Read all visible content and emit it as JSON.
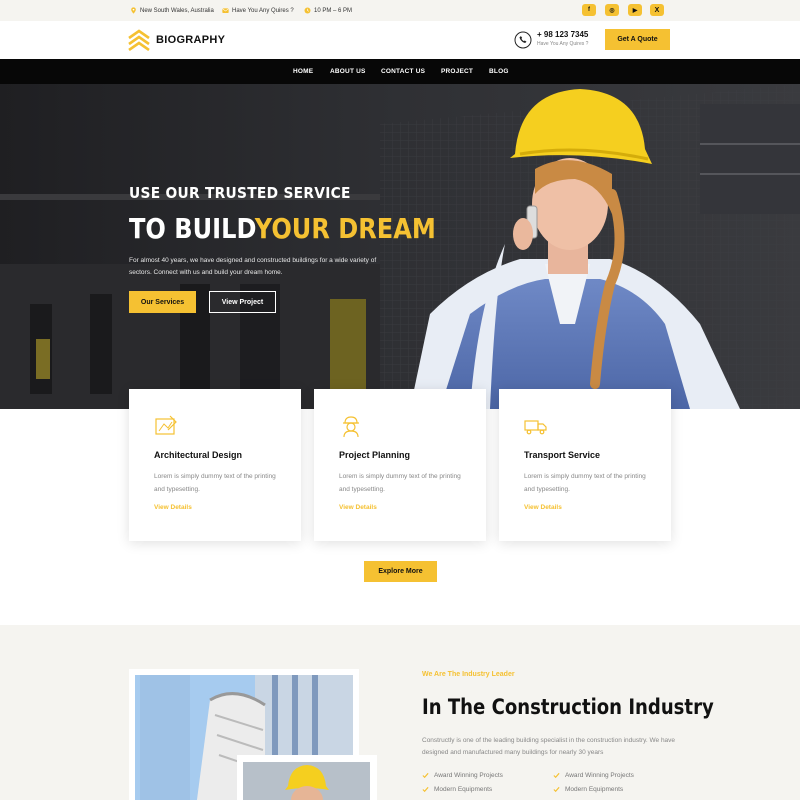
{
  "topbar": {
    "location": "New South Wales, Australia",
    "email": "Have You Any Quires ?",
    "hours": "10 PM – 6 PM",
    "social": [
      {
        "icon": "facebook-icon",
        "glyph": "f"
      },
      {
        "icon": "instagram-icon",
        "glyph": "◎"
      },
      {
        "icon": "youtube-icon",
        "glyph": "▶"
      },
      {
        "icon": "x-twitter-icon",
        "glyph": "𝕏"
      }
    ]
  },
  "header": {
    "logo": "BIOGRAPHY",
    "phone": "+ 98 123 7345",
    "phone_sub": "Have You Any Quires ?",
    "cta": "Get A Quote"
  },
  "nav": {
    "items": [
      "HOME",
      "ABOUT US",
      "CONTACT US",
      "PROJECT",
      "BLOG"
    ]
  },
  "hero": {
    "kicker": "USE OUR TRUSTED SERVICE",
    "title_main": "TO BUILD",
    "title_highlight": "YOUR DREAM",
    "description": "For almost 40 years, we have designed and constructed buildings for a wide variety of sectors. Connect with us and build your dream home.",
    "primary_button": "Our Services",
    "secondary_button": "View Project"
  },
  "services": [
    {
      "icon": "blueprint-icon",
      "title": "Architectural Design",
      "desc": "Lorem is simply dummy text of the printing and typesetting.",
      "link": "View Details"
    },
    {
      "icon": "engineer-icon",
      "title": "Project Planning",
      "desc": "Lorem is simply dummy text of the printing and typesetting.",
      "link": "View Details"
    },
    {
      "icon": "truck-icon",
      "title": "Transport Service",
      "desc": "Lorem is simply dummy text of the printing and typesetting.",
      "link": "View Details"
    }
  ],
  "explore_button": "Explore More",
  "about": {
    "kicker": "We Are The Industry Leader",
    "title": "In The Construction Industry",
    "description": "Constructly is one of the leading building specialist in the construction industry. We have designed and manufactured many buildings for nearly 30 years",
    "features": [
      "Award Winning Projects",
      "Award Winning Projects",
      "Modern Equipments",
      "Modern Equipments"
    ]
  },
  "colors": {
    "accent": "#f5c132",
    "nav_bg": "#070707",
    "section_bg": "#f5f4f0"
  }
}
